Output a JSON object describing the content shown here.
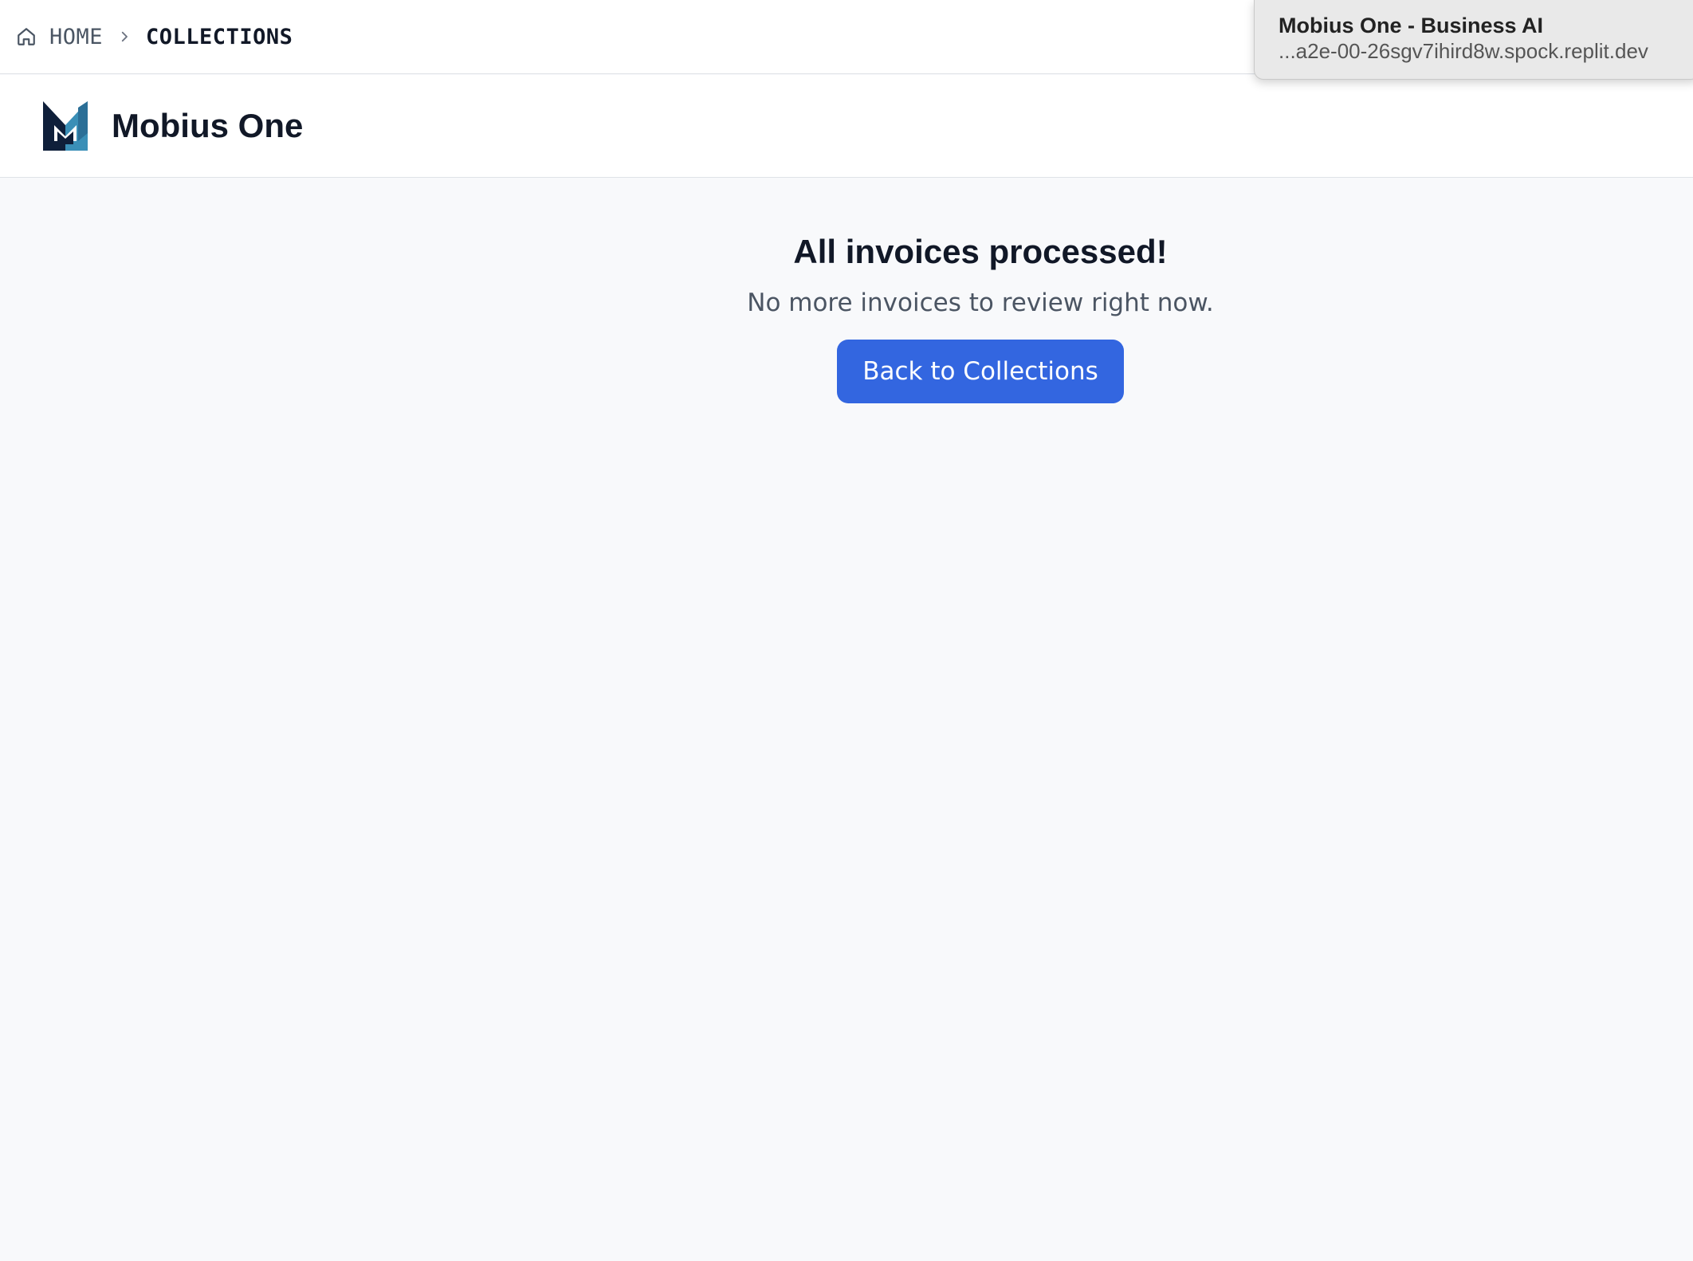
{
  "breadcrumb": {
    "home_icon": "home-icon",
    "home_label": "HOME",
    "separator_icon": "chevron-right-icon",
    "current_label": "COLLECTIONS"
  },
  "header": {
    "logo": "mobius-logo",
    "title": "Mobius One"
  },
  "main": {
    "title": "All invoices processed!",
    "subtitle": "No more invoices to review right now.",
    "back_button_label": "Back to Collections"
  },
  "tooltip": {
    "title": "Mobius One - Business AI",
    "url": "...a2e-00-26sgv7ihird8w.spock.replit.dev"
  },
  "colors": {
    "accent": "#3366e0",
    "logo_dark": "#0f1f3a",
    "logo_teal": "#3a8fb7",
    "background": "#f8f9fb"
  }
}
